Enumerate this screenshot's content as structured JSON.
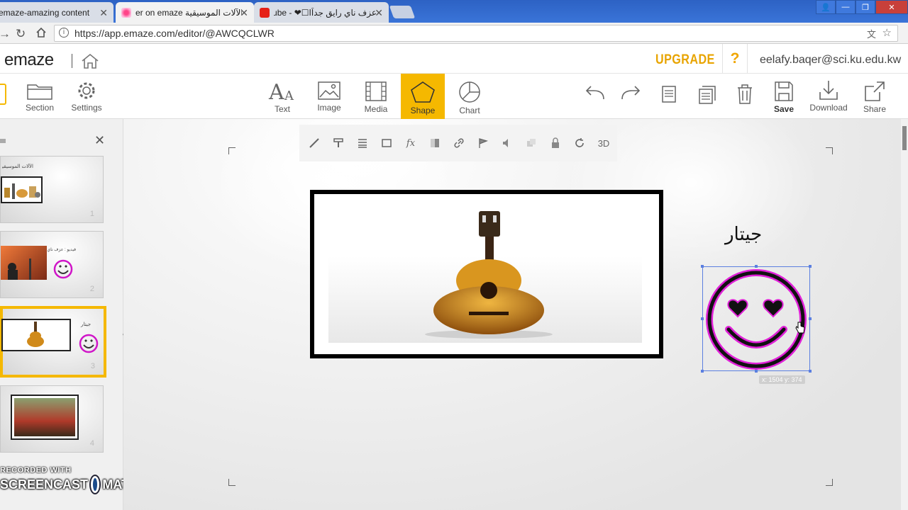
{
  "browser": {
    "tabs": [
      {
        "label": "emaze-amazing content"
      },
      {
        "label": "er on emaze الآلات الموسيقية"
      },
      {
        "label": "عزف ناي رايق جداًا☐❤ - ube"
      }
    ],
    "url": "https://app.emaze.com/editor/@AWCQCLWR"
  },
  "header": {
    "logo": "emaze",
    "upgrade_label": "UPGRADE",
    "help_label": "?",
    "user_email": "eelafy.baqer@sci.ku.edu.kw"
  },
  "toolbar": {
    "left": [
      {
        "label": "Section"
      },
      {
        "label": "Settings"
      }
    ],
    "center": [
      {
        "label": "Text"
      },
      {
        "label": "Image"
      },
      {
        "label": "Media"
      },
      {
        "label": "Shape"
      },
      {
        "label": "Chart"
      }
    ],
    "right": [
      {
        "label": "Save"
      },
      {
        "label": "Download"
      },
      {
        "label": "Share"
      }
    ]
  },
  "slides": [
    {
      "number": "1",
      "caption": "الآلات الموسيقية"
    },
    {
      "number": "2",
      "caption": "فيديو : عزف ناي"
    },
    {
      "number": "3",
      "caption": "جيتار"
    },
    {
      "number": "4",
      "caption": ""
    }
  ],
  "editbar": {
    "threed_label": "3D"
  },
  "slide": {
    "title_text": "جيتار",
    "coords": "x: 1504   y: 374"
  },
  "watermark": {
    "line1": "RECORDED WITH",
    "line2a": "SCREENCAST",
    "line2b": "MATIC"
  },
  "colors": {
    "accent": "#f5b800",
    "upgrade": "#e8a400",
    "smiley_stroke": "#e020d8",
    "selection": "#5b7fe0"
  }
}
